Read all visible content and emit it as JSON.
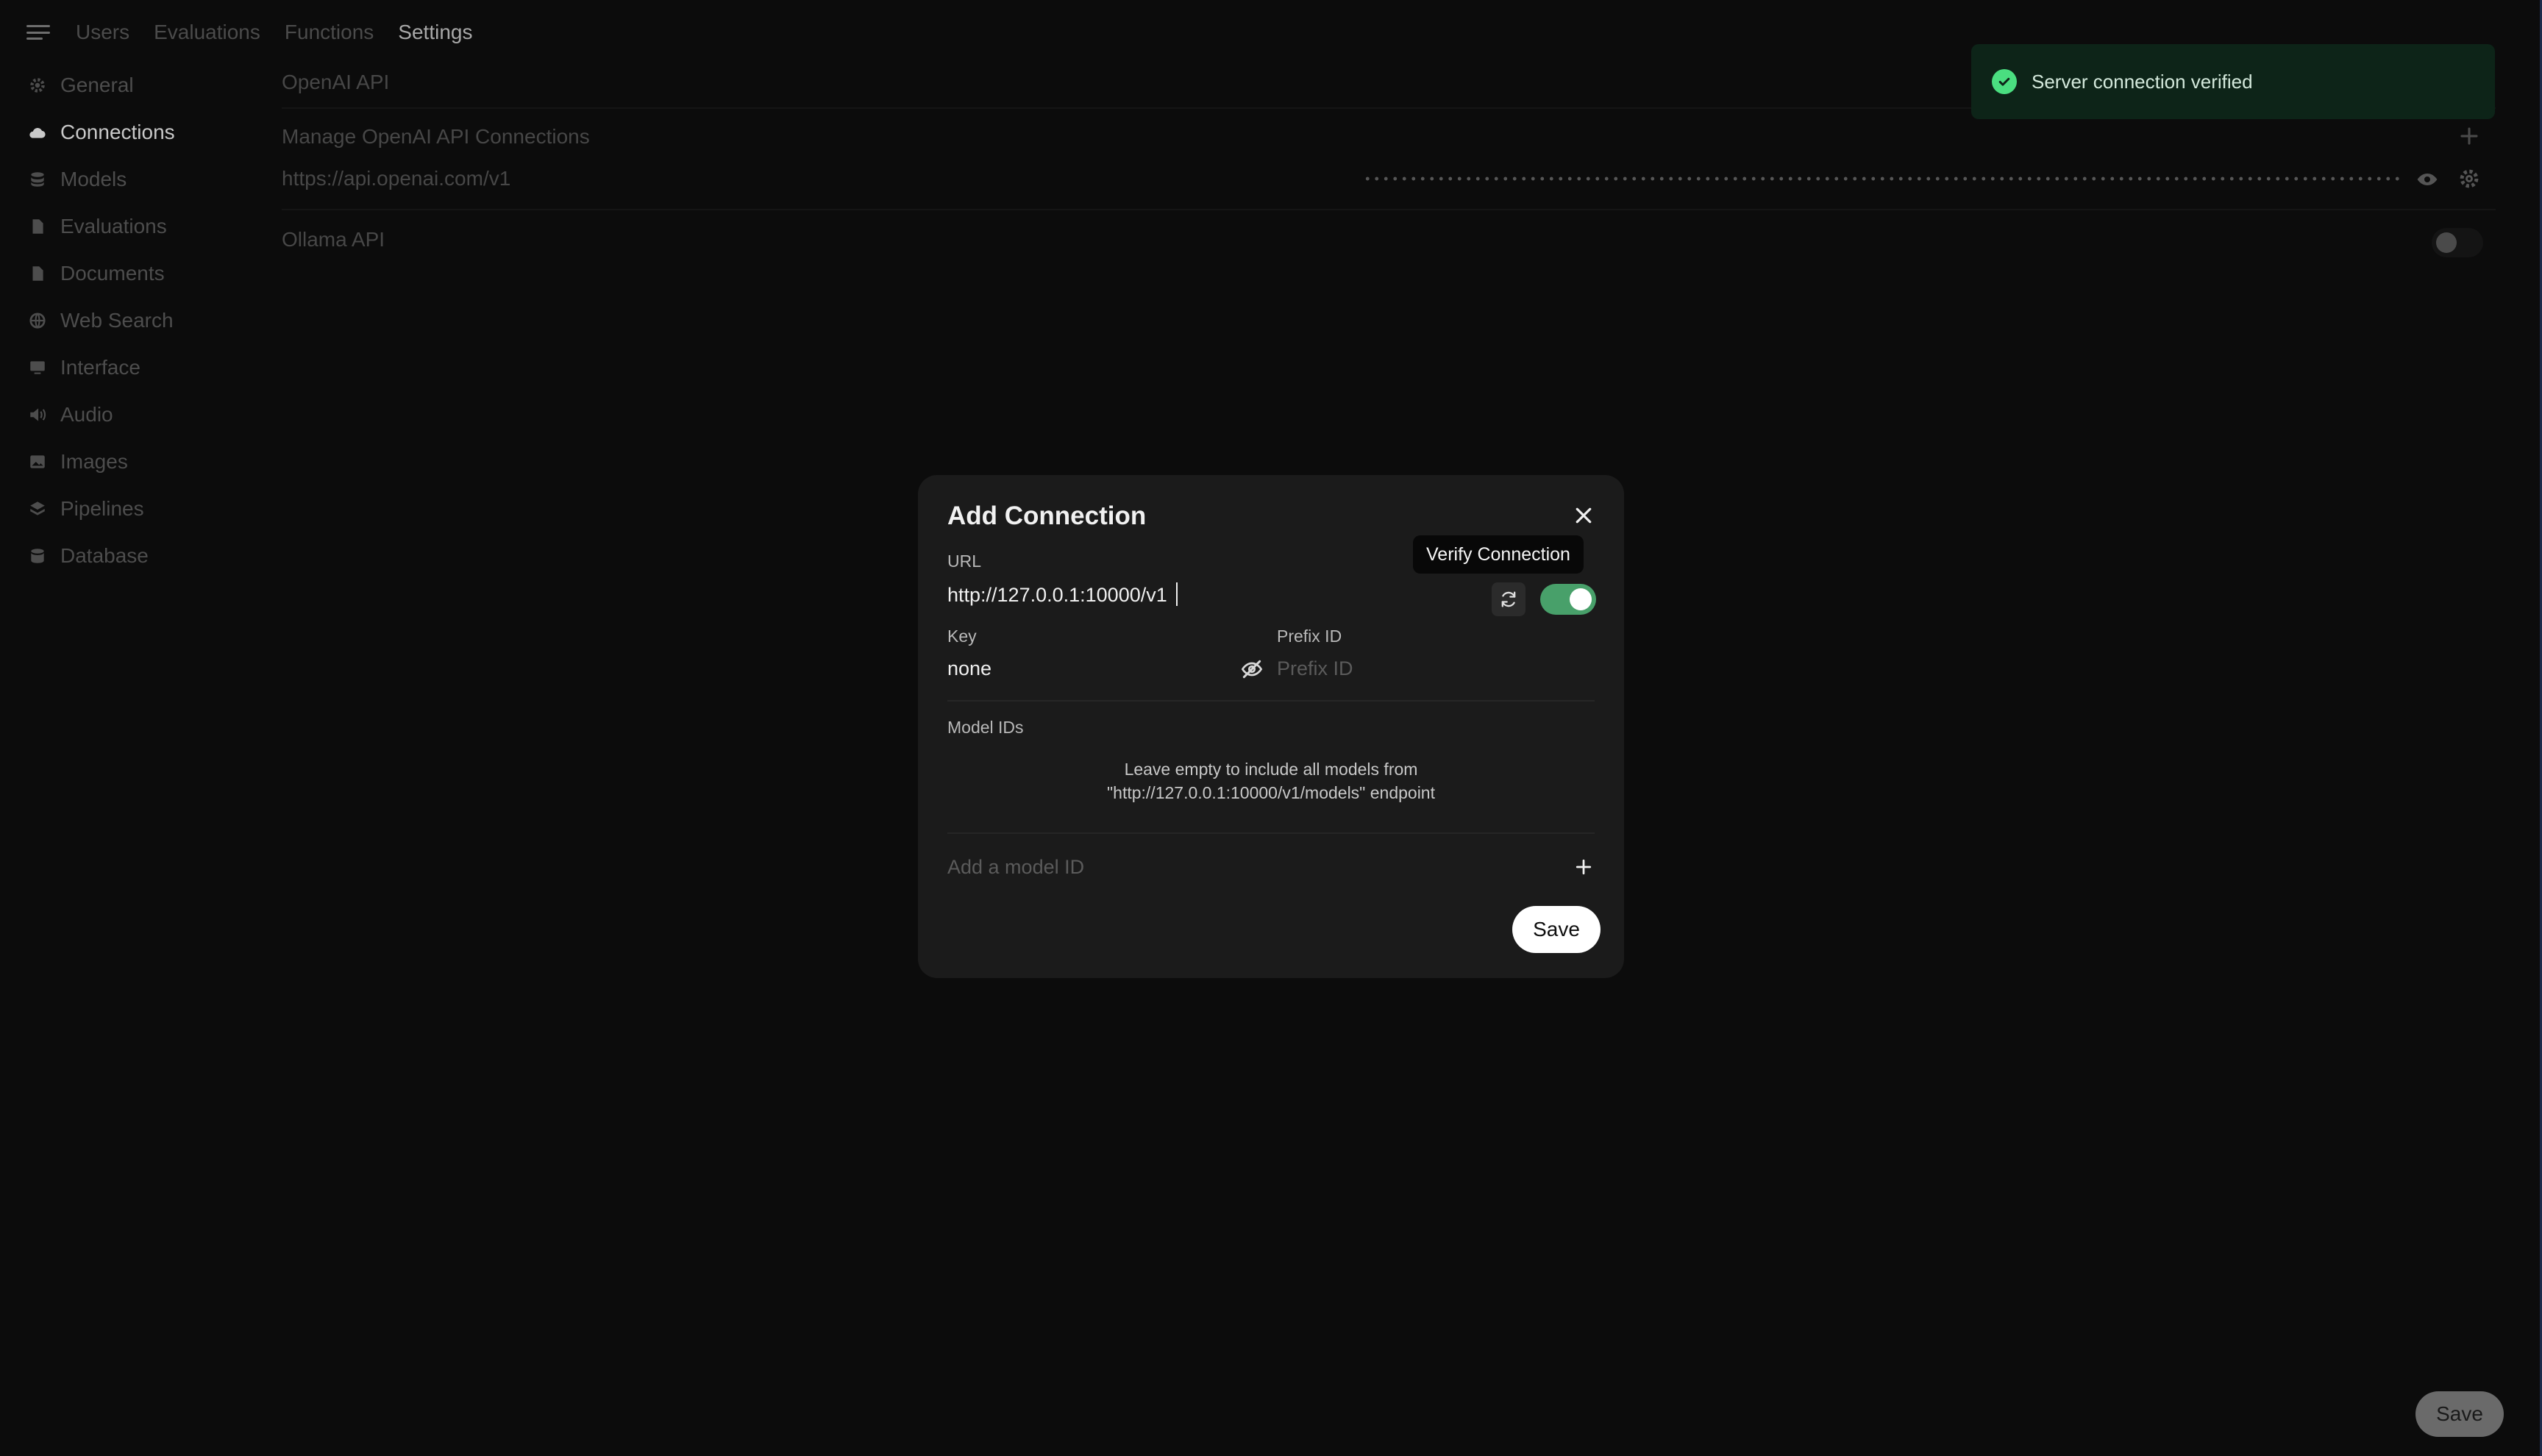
{
  "topnav": {
    "items": [
      {
        "label": "Users",
        "active": false
      },
      {
        "label": "Evaluations",
        "active": false
      },
      {
        "label": "Functions",
        "active": false
      },
      {
        "label": "Settings",
        "active": true
      }
    ]
  },
  "sidebar": {
    "items": [
      {
        "label": "General",
        "icon": "gear-icon"
      },
      {
        "label": "Connections",
        "icon": "cloud-icon",
        "active": true
      },
      {
        "label": "Models",
        "icon": "cube-stack-icon"
      },
      {
        "label": "Evaluations",
        "icon": "document-icon"
      },
      {
        "label": "Documents",
        "icon": "document-icon"
      },
      {
        "label": "Web Search",
        "icon": "globe-icon"
      },
      {
        "label": "Interface",
        "icon": "monitor-icon"
      },
      {
        "label": "Audio",
        "icon": "speaker-icon"
      },
      {
        "label": "Images",
        "icon": "image-icon"
      },
      {
        "label": "Pipelines",
        "icon": "layers-icon"
      },
      {
        "label": "Database",
        "icon": "database-icon"
      }
    ]
  },
  "main": {
    "openai_section": "OpenAI API",
    "manage_label": "Manage OpenAI API Connections",
    "connection_url": "https://api.openai.com/v1",
    "ollama_section": "Ollama API"
  },
  "toast": {
    "message": "Server connection verified",
    "icon": "check-circle-icon",
    "color": "#4ade80"
  },
  "modal": {
    "title": "Add Connection",
    "url_label": "URL",
    "url_value": "http://127.0.0.1:10000/v1",
    "tooltip": "Verify Connection",
    "key_label": "Key",
    "key_value": "none",
    "prefix_label": "Prefix ID",
    "prefix_placeholder": "Prefix ID",
    "model_ids_label": "Model IDs",
    "hint_line1": "Leave empty to include all models from",
    "hint_line2": "\"http://127.0.0.1:10000/v1/models\" endpoint",
    "add_model_placeholder": "Add a model ID",
    "save_label": "Save",
    "toggle_color": "#48a06a"
  },
  "footer": {
    "save_label": "Save"
  }
}
